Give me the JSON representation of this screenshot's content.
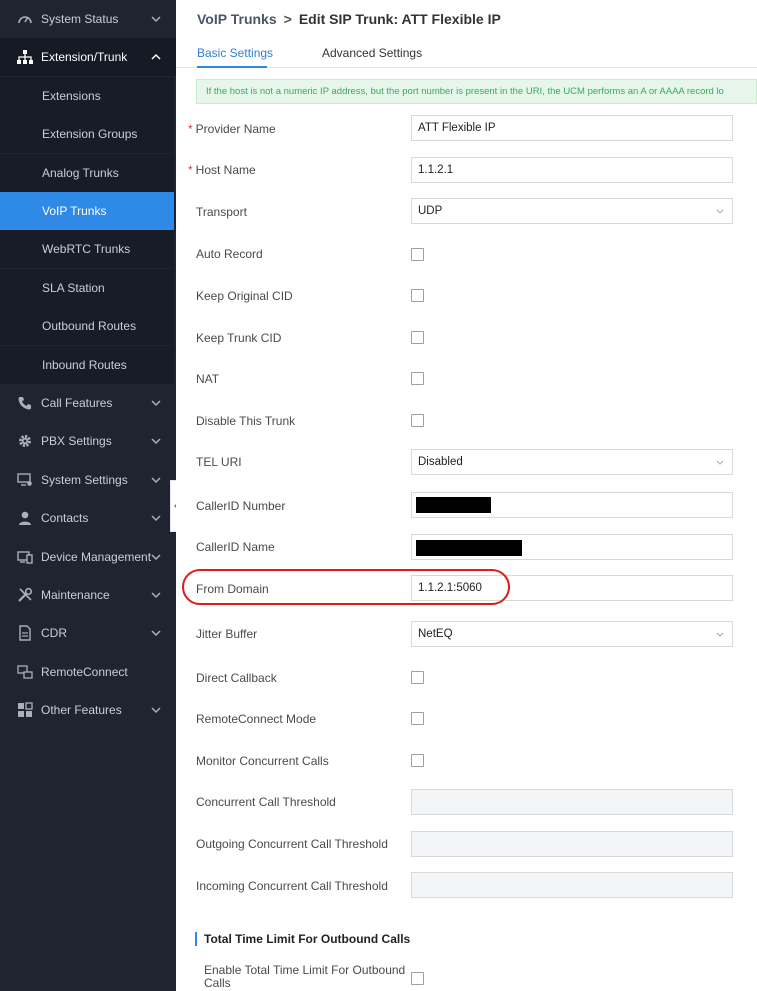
{
  "sidebar": {
    "items": [
      {
        "label": "System Status",
        "icon": "speedometer-icon"
      },
      {
        "label": "Extension/Trunk",
        "icon": "network-icon"
      },
      {
        "label": "Call Features",
        "icon": "phone-icon"
      },
      {
        "label": "PBX Settings",
        "icon": "gear-icon"
      },
      {
        "label": "System Settings",
        "icon": "monitor-settings-icon"
      },
      {
        "label": "Contacts",
        "icon": "person-icon"
      },
      {
        "label": "Device Management",
        "icon": "device-icon"
      },
      {
        "label": "Maintenance",
        "icon": "tools-icon"
      },
      {
        "label": "CDR",
        "icon": "document-icon"
      },
      {
        "label": "RemoteConnect",
        "icon": "remote-icon"
      },
      {
        "label": "Other Features",
        "icon": "grid-icon"
      }
    ],
    "subitems": [
      {
        "label": "Extensions"
      },
      {
        "label": "Extension Groups"
      },
      {
        "label": "Analog Trunks"
      },
      {
        "label": "VoIP Trunks"
      },
      {
        "label": "WebRTC Trunks"
      },
      {
        "label": "SLA Station"
      },
      {
        "label": "Outbound Routes"
      },
      {
        "label": "Inbound Routes"
      }
    ],
    "active_subitem": "VoIP Trunks"
  },
  "header": {
    "breadcrumb_parent": "VoIP Trunks",
    "breadcrumb_sep": ">",
    "breadcrumb_current": "Edit SIP Trunk: ATT Flexible IP"
  },
  "tabs": [
    {
      "label": "Basic Settings"
    },
    {
      "label": "Advanced Settings"
    }
  ],
  "notice": "If the host is not a numeric IP address, but the port number is present in the URI, the UCM performs an A or AAAA record lo",
  "form": {
    "provider_name": {
      "label": "Provider Name",
      "value": "ATT Flexible IP",
      "required": "*"
    },
    "host_name": {
      "label": "Host Name",
      "value": "1.1.2.1",
      "required": "*"
    },
    "transport": {
      "label": "Transport",
      "value": "UDP"
    },
    "auto_record": {
      "label": "Auto Record"
    },
    "keep_original_cid": {
      "label": "Keep Original CID"
    },
    "keep_trunk_cid": {
      "label": "Keep Trunk CID"
    },
    "nat": {
      "label": "NAT"
    },
    "disable_trunk": {
      "label": "Disable This Trunk"
    },
    "tel_uri": {
      "label": "TEL URI",
      "value": "Disabled"
    },
    "callerid_number": {
      "label": "CallerID Number"
    },
    "callerid_name": {
      "label": "CallerID Name"
    },
    "from_domain": {
      "label": "From Domain",
      "value": "1.1.2.1:5060"
    },
    "jitter_buffer": {
      "label": "Jitter Buffer",
      "value": "NetEQ"
    },
    "direct_callback": {
      "label": "Direct Callback"
    },
    "remoteconnect_mode": {
      "label": "RemoteConnect Mode"
    },
    "monitor_concurrent_calls": {
      "label": "Monitor Concurrent Calls"
    },
    "concurrent_call_threshold": {
      "label": "Concurrent Call Threshold"
    },
    "outgoing_concurrent_call_threshold": {
      "label": "Outgoing Concurrent Call Threshold"
    },
    "incoming_concurrent_call_threshold": {
      "label": "Incoming Concurrent Call Threshold"
    }
  },
  "section": {
    "title": "Total Time Limit For Outbound Calls",
    "enable_label": "Enable Total Time Limit For Outbound Calls"
  },
  "colors": {
    "sidebar_bg": "#1f2430",
    "active_blue": "#2e8ae6",
    "highlight_red": "#e01b1b",
    "notice_green": "#3aaa5a"
  }
}
